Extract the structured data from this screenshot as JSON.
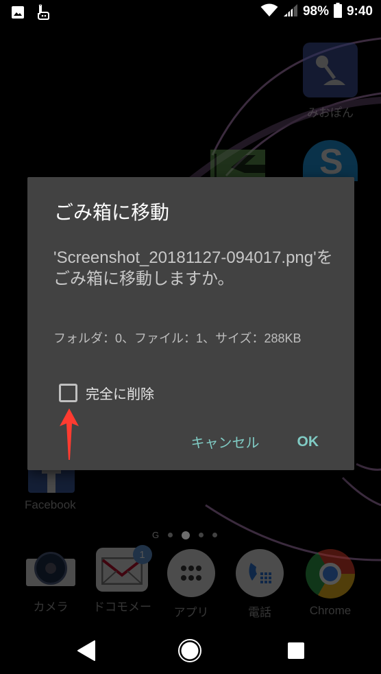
{
  "status_bar": {
    "notification_icons": [
      "image-icon",
      "hand-touch-icon"
    ],
    "battery": "98%",
    "time": "9:40"
  },
  "home_screen": {
    "apps": [
      {
        "id": "miopon",
        "label": "みおぽん",
        "icon": "microphone-app-icon",
        "color": "#3b4a8a"
      },
      {
        "id": "skype",
        "label": "",
        "icon": "skype-icon",
        "color": "#1e8ccf"
      },
      {
        "id": "green-app",
        "label": "",
        "icon": "arrow-left-app-icon",
        "color": "#5a8a4a"
      },
      {
        "id": "facebook",
        "label": "Facebook",
        "icon": "facebook-icon",
        "color": "#3b5998"
      }
    ],
    "page_indicator": {
      "google_label": "G",
      "pages": 4,
      "current": 2
    },
    "dock": [
      {
        "id": "camera",
        "label": "カメラ",
        "icon": "camera-icon"
      },
      {
        "id": "docomo-mail",
        "label": "ドコモメー",
        "icon": "mail-icon",
        "badge": "1"
      },
      {
        "id": "apps",
        "label": "アプリ",
        "icon": "app-drawer-icon"
      },
      {
        "id": "phone",
        "label": "電話",
        "icon": "phone-icon"
      },
      {
        "id": "chrome",
        "label": "Chrome",
        "icon": "chrome-icon"
      }
    ]
  },
  "dialog": {
    "title": "ごみ箱に移動",
    "message": "'Screenshot_20181127-094017.png'をごみ箱に移動しますか。",
    "info": "フォルダ：0、ファイル：1、サイズ：288KB",
    "checkbox_label": "完全に削除",
    "checkbox_checked": false,
    "cancel_label": "キャンセル",
    "ok_label": "OK",
    "accent_color": "#80cbc4"
  },
  "annotation": {
    "arrow_color": "#ff3b30",
    "points_to": "checkbox"
  },
  "nav_bar": {
    "buttons": [
      "back",
      "home",
      "recents"
    ]
  }
}
